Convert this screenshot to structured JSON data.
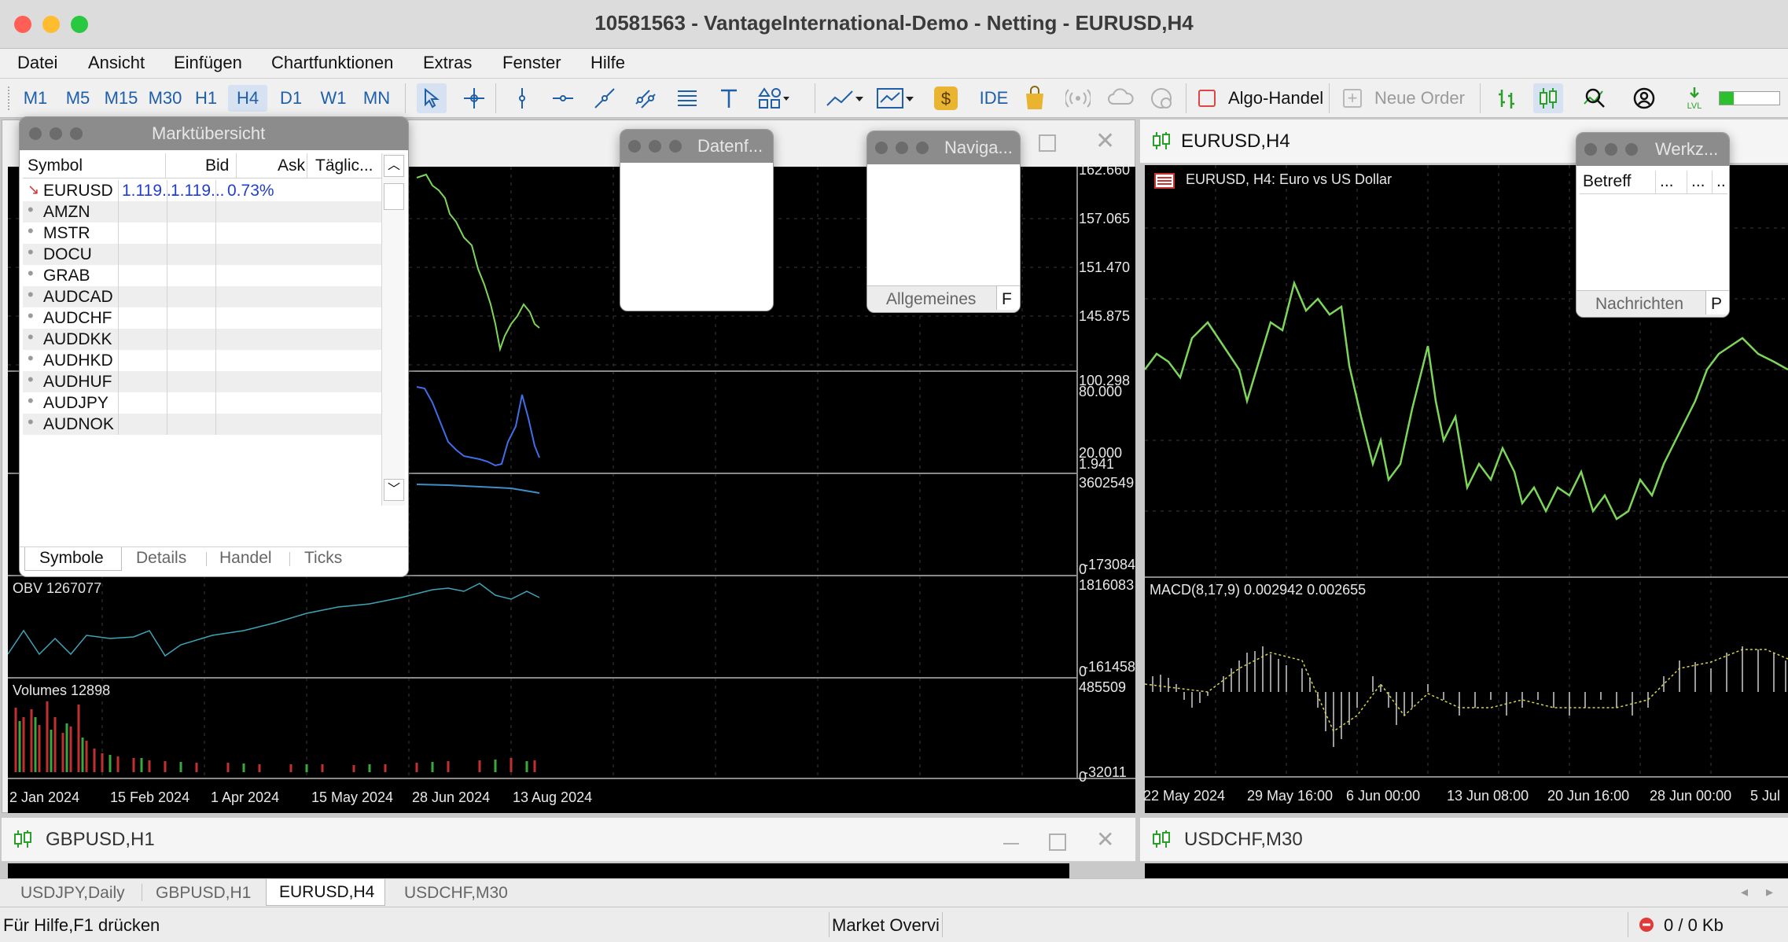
{
  "window": {
    "title": "10581563 - VantageInternational-Demo - Netting - EURUSD,H4",
    "colors": {
      "close": "#ff5f57",
      "minimize": "#febc2e",
      "zoom": "#28c840"
    }
  },
  "menu": [
    "Datei",
    "Ansicht",
    "Einfügen",
    "Chartfunktionen",
    "Extras",
    "Fenster",
    "Hilfe"
  ],
  "toolbar": {
    "timeframes": [
      "M1",
      "M5",
      "M15",
      "M30",
      "H1",
      "H4",
      "D1",
      "W1",
      "MN"
    ],
    "active_timeframe": "H4",
    "ide_label": "IDE",
    "algo_label": "Algo-Handel",
    "order_label": "Neue Order"
  },
  "left_chart": {
    "price_ticks": [
      "162.660",
      "157.065",
      "151.470",
      "145.875"
    ],
    "rsi_ticks": [
      "100.298",
      "80.000",
      "20.000",
      "1.941"
    ],
    "ad_ticks": [
      "3602549",
      "0",
      "-173084"
    ],
    "obv_label": "OBV 1267077",
    "obv_ticks": [
      "1816083",
      "0",
      "-161458"
    ],
    "volumes_label": "Volumes 12898",
    "vol_ticks": [
      "485509",
      "0",
      "-32011"
    ],
    "dates": [
      "2 Jan 2024",
      "15 Feb 2024",
      "1 Apr 2024",
      "15 May 2024",
      "28 Jun 2024",
      "13 Aug 2024"
    ]
  },
  "right_chart": {
    "title": "EURUSD,H4",
    "caption": "EURUSD, H4:  Euro vs US Dollar",
    "macd_label": "MACD(8,17,9) 0.002942 0.002655",
    "dates": [
      "22 May 2024",
      "29 May 16:00",
      "6 Jun 00:00",
      "13 Jun 08:00",
      "20 Jun 16:00",
      "28 Jun 00:00",
      "5 Jul"
    ]
  },
  "market_watch": {
    "title": "Marktübersicht",
    "columns": [
      "Symbol",
      "Bid",
      "Ask",
      "Täglic..."
    ],
    "rows": [
      {
        "symbol": "EURUSD",
        "bid": "1.119...",
        "ask": "1.119...",
        "daily": "0.73%"
      },
      {
        "symbol": "AMZN",
        "bid": "",
        "ask": "",
        "daily": ""
      },
      {
        "symbol": "MSTR",
        "bid": "",
        "ask": "",
        "daily": ""
      },
      {
        "symbol": "DOCU",
        "bid": "",
        "ask": "",
        "daily": ""
      },
      {
        "symbol": "GRAB",
        "bid": "",
        "ask": "",
        "daily": ""
      },
      {
        "symbol": "AUDCAD",
        "bid": "",
        "ask": "",
        "daily": ""
      },
      {
        "symbol": "AUDCHF",
        "bid": "",
        "ask": "",
        "daily": ""
      },
      {
        "symbol": "AUDDKK",
        "bid": "",
        "ask": "",
        "daily": ""
      },
      {
        "symbol": "AUDHKD",
        "bid": "",
        "ask": "",
        "daily": ""
      },
      {
        "symbol": "AUDHUF",
        "bid": "",
        "ask": "",
        "daily": ""
      },
      {
        "symbol": "AUDJPY",
        "bid": "",
        "ask": "",
        "daily": ""
      },
      {
        "symbol": "AUDNOK",
        "bid": "",
        "ask": "",
        "daily": ""
      }
    ],
    "tabs": [
      "Symbole",
      "Details",
      "Handel",
      "Ticks"
    ]
  },
  "data_window": {
    "title": "Datenf..."
  },
  "navigator": {
    "title": "Naviga...",
    "tab": "Allgemeines",
    "tab2": "F"
  },
  "toolbox": {
    "title": "Werkz...",
    "col": "Betreff",
    "col2": "...",
    "col3": "...",
    "col4": "..",
    "tab": "Nachrichten",
    "tab2": "P"
  },
  "bottom_charts": {
    "left": "GBPUSD,H1",
    "right": "USDCHF,M30"
  },
  "chart_tabs": [
    "USDJPY,Daily",
    "GBPUSD,H1",
    "EURUSD,H4",
    "USDCHF,M30"
  ],
  "active_chart_tab": "EURUSD,H4",
  "status": {
    "help": "Für Hilfe,F1 drücken",
    "profile": "Market Overvi",
    "traffic": "0 / 0 Kb"
  }
}
